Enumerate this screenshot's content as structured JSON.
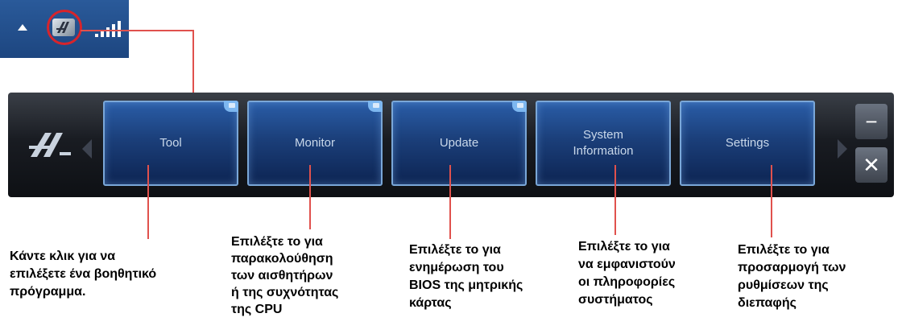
{
  "tray": {
    "up_arrow_icon": "triangle-up",
    "app_icon": "ai-suite-icon",
    "signal_icon": "signal-bars-icon"
  },
  "toolbar": {
    "logo_icon": "ai-suite-logo-icon",
    "buttons": [
      {
        "label": "Tool",
        "has_corner_badge": true
      },
      {
        "label": "Monitor",
        "has_corner_badge": true
      },
      {
        "label": "Update",
        "has_corner_badge": true
      },
      {
        "label_line1": "System",
        "label_line2": "Information",
        "has_corner_badge": false
      },
      {
        "label": "Settings",
        "has_corner_badge": false
      }
    ],
    "minimize_label": "−",
    "close_label": "✕"
  },
  "captions": [
    {
      "lines": [
        "Κάντε κλικ για να",
        "επιλέξετε ένα βοηθητικό",
        "πρόγραμμα."
      ]
    },
    {
      "lines": [
        "Επιλέξτε το για",
        "παρακολούθηση",
        "των αισθητήρων",
        "ή της συχνότητας",
        "της CPU"
      ]
    },
    {
      "lines": [
        "Επιλέξτε το για",
        "ενημέρωση του",
        "BIOS της μητρικής",
        "κάρτας"
      ]
    },
    {
      "lines": [
        "Επιλέξτε το για",
        "να εμφανιστούν",
        "οι πληροφορίες",
        "συστήματος"
      ]
    },
    {
      "lines": [
        "Επιλέξτε το για",
        "προσαρμογή των",
        "ρυθμίσεων της",
        "διεπαφής"
      ]
    }
  ],
  "colors": {
    "callout": "#e0514d",
    "button_blue": "#1b3f7a",
    "tray_blue": "#1d4680"
  }
}
